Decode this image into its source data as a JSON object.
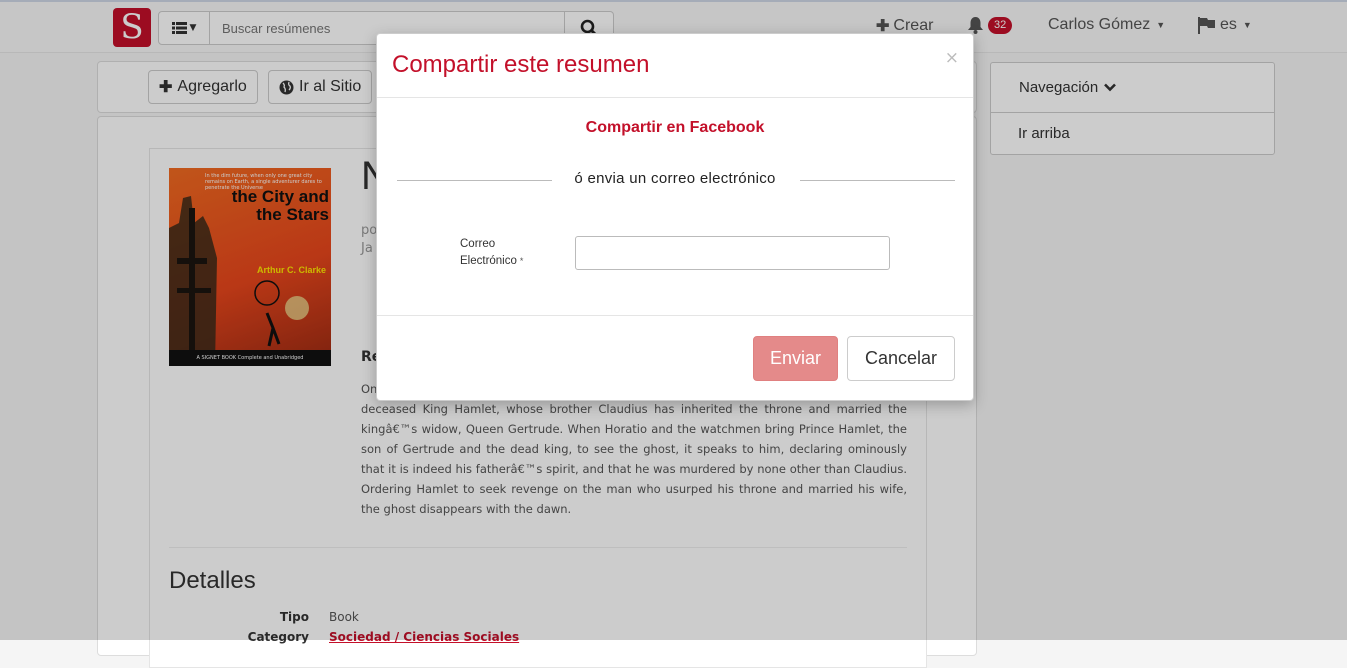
{
  "header": {
    "logo_letter": "S",
    "search_placeholder": "Buscar resúmenes",
    "create_label": "Crear",
    "notifications_count": "32",
    "user_name": "Carlos Gómez",
    "language": "es"
  },
  "actions": {
    "add_label": "Agregarlo",
    "site_label": "Ir al Sitio"
  },
  "book": {
    "cover": {
      "tagline": "In the dim future, when only one great city remains on Earth, a single adventurer dares to penetrate the Universe",
      "title": "the City and the Stars",
      "author": "Arthur C. Clarke",
      "footer": "A SIGNET BOOK Complete and Unabridged"
    },
    "title_partial": "N",
    "byline_partial": [
      "po",
      "Ja"
    ],
    "section_partial": "Re",
    "summary": "On by a pair of watchmen, then by the scholar Horatio, the ghost resembles the recently deceased King Hamlet, whose brother Claudius has inherited the throne and married the kingâ€™s widow, Queen Gertrude. When Horatio and the watchmen bring Prince Hamlet, the son of Gertrude and the dead king, to see the ghost, it speaks to him, declaring ominously that it is indeed his fatherâ€™s spirit, and that he was murdered by none other than Claudius. Ordering Hamlet to seek revenge on the man who usurped his throne and married his wife, the ghost disappears with the dawn.",
    "details_title": "Detalles",
    "details": [
      {
        "key": "Tipo",
        "value": "Book"
      },
      {
        "key": "Category",
        "value": "Sociedad / Ciencias Sociales"
      }
    ]
  },
  "sidebar": {
    "nav_label": "Navegación",
    "top_link": "Ir arriba"
  },
  "modal": {
    "title": "Compartir este resumen",
    "close": "×",
    "facebook_link": "Compartir en Facebook",
    "or_text": "ó envia un correo electrónico",
    "email_label_1": "Correo",
    "email_label_2": "Electrónico",
    "required_mark": "*",
    "email_value": "",
    "send_label": "Enviar",
    "cancel_label": "Cancelar"
  },
  "colors": {
    "brand": "#c3102a",
    "send_disabled": "#e48a8a"
  }
}
